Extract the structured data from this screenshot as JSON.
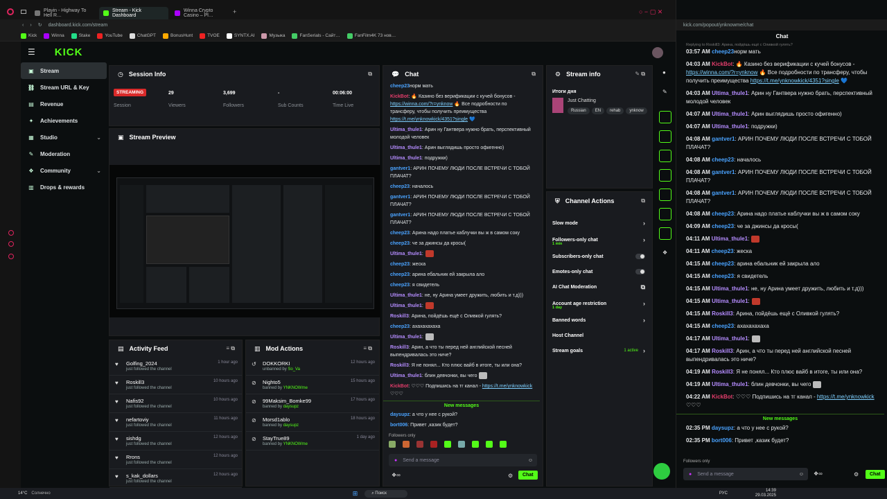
{
  "browser": {
    "tabs": [
      "Playin - Highway To Hell R…",
      "Stream - Kick Dashboard",
      "Winna Crypto Casino – Pl…"
    ],
    "url": "dashboard.kick.com/stream",
    "url_popout": "kick.com/popout/ynknowme/chat",
    "bookmarks": [
      "Kick",
      "Winna",
      "Stake",
      "YouTube",
      "ChatGPT",
      "BonusHunt",
      "TVOE",
      "SYNTX.AI",
      "Музыка",
      "FanSerials - Сайт…",
      "FanFilm4K 73 нов…"
    ]
  },
  "kick": {
    "logo": "KICK",
    "sidebar": [
      "Stream",
      "Stream URL & Key",
      "Revenue",
      "Achievements",
      "Studio",
      "Moderation",
      "Community",
      "Drops & rewards"
    ]
  },
  "session": {
    "title": "Session Info",
    "badge": "STREAMING",
    "session_label": "Session",
    "viewers": "29",
    "viewers_label": "Viewers",
    "followers": "3,699",
    "followers_label": "Followers",
    "subs": "-",
    "subs_label": "Sub Counts",
    "time": "00:06:00",
    "time_label": "Time Live"
  },
  "preview": {
    "title": "Stream Preview"
  },
  "activity": {
    "title": "Activity Feed",
    "items": [
      {
        "name": "Golfing_2024",
        "sub": "just followed the channel",
        "time": "1 hour ago"
      },
      {
        "name": "Roskill3",
        "sub": "just followed the channel",
        "time": "10 hours ago"
      },
      {
        "name": "Nafis92",
        "sub": "just followed the channel",
        "time": "10 hours ago"
      },
      {
        "name": "nefartoviy",
        "sub": "just followed the channel",
        "time": "11 hours ago"
      },
      {
        "name": "sishdg",
        "sub": "just followed the channel",
        "time": "12 hours ago"
      },
      {
        "name": "Rrons",
        "sub": "just followed the channel",
        "time": "12 hours ago"
      },
      {
        "name": "s_kak_dollars",
        "sub": "just followed the channel",
        "time": "12 hours ago"
      }
    ]
  },
  "mod": {
    "title": "Mod Actions",
    "items": [
      {
        "name": "DOKKORKI",
        "pre": "unbanned by ",
        "by": "So_Va",
        "time": "12 hours ago"
      },
      {
        "name": "Nighto5",
        "pre": "banned by ",
        "by": "YNKNOWme",
        "time": "15 hours ago"
      },
      {
        "name": "99Maksim_Bomke99",
        "pre": "banned by ",
        "by": "daysupz",
        "time": "17 hours ago"
      },
      {
        "name": "Morsd1ablo",
        "pre": "banned by ",
        "by": "daysupz",
        "time": "18 hours ago"
      },
      {
        "name": "StayTrue89",
        "pre": "banned by ",
        "by": "YNKNOWme",
        "time": "1 day ago"
      }
    ]
  },
  "chat": {
    "title": "Chat",
    "new_messages": "New messages",
    "followers_only": "Followers only",
    "placeholder": "Send a message",
    "send": "Chat",
    "messages": [
      {
        "ts": "",
        "user": "cheep23",
        "color": "#53fc18",
        "text": "норм мать"
      },
      {
        "ts": "03:57 AM",
        "user": "cheep23",
        "color": "#4aa3ff",
        "text": "норм мать"
      },
      {
        "ts": "04:03 AM",
        "user": "KickBot",
        "color": "#e23d6b",
        "text": ": 🔥 Казино без верификации с кучей бонусов - https://winna.com/?r=ynknow 🔥 Все подробности по трансферу, чтобы получить преимущества https://t.me/ynknowkick/4351?single 💙"
      },
      {
        "ts": "04:03 AM",
        "user": "Ultima_thule1",
        "color": "#b58cff",
        "text": ": Арин ну Гантвера нужно брать, перспективный молодой человек"
      },
      {
        "ts": "04:07 AM",
        "user": "Ultima_thule1",
        "color": "#b58cff",
        "text": ": Арин выглядишь просто офигенно)"
      },
      {
        "ts": "04:07 AM",
        "user": "Ultima_thule1",
        "color": "#b58cff",
        "text": ": подружки)"
      },
      {
        "ts": "04:08 AM",
        "user": "gantver1",
        "color": "#4aa3ff",
        "text": ": АРИН ПОЧЕМУ ЛЮДИ ПОСЛЕ ВСТРЕЧИ С ТОБОЙ ПЛАЧАТ?"
      },
      {
        "ts": "04:08 AM",
        "user": "cheep23",
        "color": "#4aa3ff",
        "text": ": началось"
      },
      {
        "ts": "04:08 AM",
        "user": "gantver1",
        "color": "#4aa3ff",
        "text": ": АРИН ПОЧЕМУ ЛЮДИ ПОСЛЕ ВСТРЕЧИ С ТОБОЙ ПЛАЧАТ?"
      },
      {
        "ts": "04:08 AM",
        "user": "gantver1",
        "color": "#4aa3ff",
        "text": ": АРИН ПОЧЕМУ ЛЮДИ ПОСЛЕ ВСТРЕЧИ С ТОБОЙ ПЛАЧАТ?"
      },
      {
        "ts": "04:08 AM",
        "user": "cheep23",
        "color": "#4aa3ff",
        "text": ": Арина надо платье каблучки вы ж в самом соку"
      },
      {
        "ts": "04:09 AM",
        "user": "cheep23",
        "color": "#4aa3ff",
        "text": ": че за джинсы да кросы("
      },
      {
        "ts": "04:11 AM",
        "user": "Ultima_thule1",
        "color": "#b58cff",
        "text": ":",
        "emote": "red"
      },
      {
        "ts": "04:11 AM",
        "user": "cheep23",
        "color": "#4aa3ff",
        "text": ": жеска"
      },
      {
        "ts": "04:15 AM",
        "user": "cheep23",
        "color": "#4aa3ff",
        "text": ": арина ебальник ей закрыла ало"
      },
      {
        "ts": "04:15 AM",
        "user": "cheep23",
        "color": "#4aa3ff",
        "text": ": я свидетель"
      },
      {
        "ts": "04:15 AM",
        "user": "Ultima_thule1",
        "color": "#b58cff",
        "text": ": не, ну Арина умеет дружить, любить и т.д)))"
      },
      {
        "ts": "04:15 AM",
        "user": "Ultima_thule1",
        "color": "#b58cff",
        "text": ":",
        "emote": "red"
      },
      {
        "ts": "04:15 AM",
        "user": "Roskill3",
        "color": "#b58cff",
        "text": ": Арина, пойдёшь ещё с Оливкой гулять?"
      },
      {
        "ts": "04:15 AM",
        "user": "cheep23",
        "color": "#4aa3ff",
        "text": ": ахахахахаха"
      },
      {
        "ts": "04:17 AM",
        "user": "Ultima_thule1",
        "color": "#b58cff",
        "text": ":",
        "emote": "cat"
      },
      {
        "ts": "04:17 AM",
        "user": "Roskill3",
        "color": "#b58cff",
        "text": ": Арин, а что ты перед ней английской песней выпендривалась это ниче?"
      },
      {
        "ts": "04:19 AM",
        "user": "Roskill3",
        "color": "#b58cff",
        "text": ": Я не понял... Кто плюс вайб в итоге, ты или она?"
      },
      {
        "ts": "04:19 AM",
        "user": "Ultima_thule1",
        "color": "#b58cff",
        "text": ": блин девчонки, вы чего",
        "emote": "cat"
      },
      {
        "ts": "04:22 AM",
        "user": "KickBot",
        "color": "#e23d6b",
        "text": ": ♡♡♡ Подпишись на тг канал - https://t.me/ynknowkick ♡♡♡"
      }
    ],
    "after": [
      {
        "ts": "02:35 PM",
        "user": "daysupz",
        "color": "#4aa3ff",
        "text": ": а что у нее с рукой?"
      },
      {
        "ts": "02:35 PM",
        "user": "bort006",
        "color": "#4aa3ff",
        "text": ": Привет ,казик будет?"
      }
    ]
  },
  "stream_info": {
    "title": "Stream info",
    "subtitle": "Итоги дня",
    "category": "Just Chatting",
    "tags": [
      "Russian",
      "EN",
      "rehab",
      "ynknow"
    ]
  },
  "channel_actions": {
    "title": "Channel Actions",
    "items": [
      {
        "label": "Slow mode",
        "kind": "chev"
      },
      {
        "label": "Followers-only chat",
        "kind": "chev",
        "sub": "1 min"
      },
      {
        "label": "Subscribers-only chat",
        "kind": "toggle"
      },
      {
        "label": "Emotes-only chat",
        "kind": "toggle"
      },
      {
        "label": "AI Chat Moderation",
        "kind": "ext"
      },
      {
        "label": "Account age restriction",
        "kind": "chev",
        "sub": "1 day"
      },
      {
        "label": "Banned words",
        "kind": "chev"
      },
      {
        "label": "Host Channel",
        "kind": "none"
      },
      {
        "label": "Stream goals",
        "kind": "chev",
        "extra": "1 active"
      }
    ]
  },
  "popout": {
    "title": "Chat",
    "replying": "Replying to Roskill3: Арина, пойдёшь ещё с Оливкой гулять?"
  },
  "taskbar": {
    "temp": "14°C",
    "cond": "Солнечно",
    "search": "Поиск",
    "lang": "РУС",
    "time": "14:39",
    "date": "29.03.2025"
  },
  "colors": {
    "accent": "#53fc18",
    "bg": "#0b0e0f",
    "panel": "#191b1f",
    "live": "#d92a2a"
  }
}
